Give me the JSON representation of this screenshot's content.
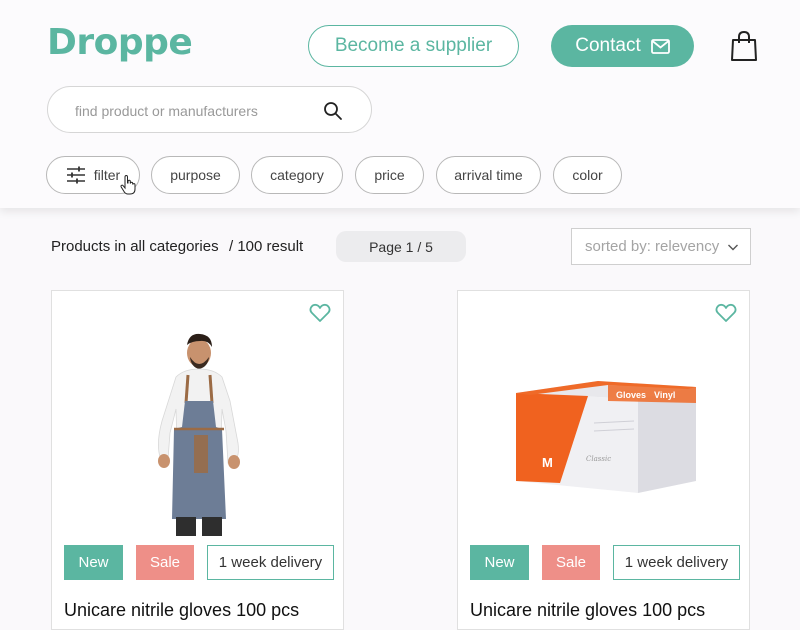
{
  "header": {
    "logo": "Droppe",
    "supplier_label": "Become a supplier",
    "contact_label": "Contact",
    "cart_icon": "shopping-bag-icon"
  },
  "search": {
    "placeholder": "find product or manufacturers",
    "value": "",
    "icon": "search-icon"
  },
  "filters": {
    "filter_label": "filter",
    "chips": [
      "purpose",
      "category",
      "price",
      "arrival time",
      "color"
    ]
  },
  "results": {
    "label": "Products in all categories",
    "count": "/ 100 result",
    "page": "Page 1 / 5",
    "sort_label": "sorted by: relevency"
  },
  "products": [
    {
      "image": "apron-model-image",
      "badges": {
        "new": "New",
        "sale": "Sale",
        "delivery": "1 week delivery"
      },
      "title": "Unicare nitrile gloves 100 pcs"
    },
    {
      "image": "vinyl-gloves-box-image",
      "box_text": {
        "brand": "Gloves",
        "type": "Vinyl",
        "size": "M",
        "series": "Classic"
      },
      "badges": {
        "new": "New",
        "sale": "Sale",
        "delivery": "1 week delivery"
      },
      "title": "Unicare nitrile gloves 100 pcs"
    }
  ],
  "colors": {
    "accent": "#5bb6a1",
    "sale": "#ee8f88",
    "background": "#faf9fb"
  }
}
